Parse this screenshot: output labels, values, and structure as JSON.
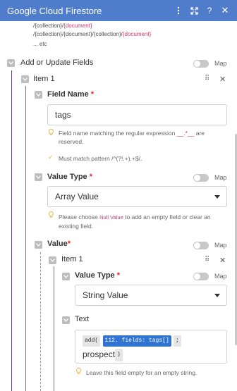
{
  "header": {
    "title": "Google Cloud Firestore",
    "icons": [
      "more-vertical-icon",
      "expand-icon",
      "help-icon",
      "close-icon"
    ]
  },
  "path_examples": {
    "line1_prefix": "/{collection}/",
    "line1_suffix": "{document}",
    "line2_prefix": "/{collection}/{document}/{collection}/",
    "line2_suffix": "{document}",
    "line3": "... etc"
  },
  "section": {
    "label": "Add or Update Fields",
    "map_label": "Map"
  },
  "item1": {
    "label": "Item 1",
    "field_name": {
      "label": "Field Name",
      "required_mark": "*",
      "value": "tags",
      "hint_prefix": "Field name matching the regular expression",
      "hint_code": "__.*__",
      "hint_suffix": "are reserved.",
      "pattern_hint": "Must match pattern /^(?!.+).+$/."
    },
    "value_type": {
      "label": "Value Type",
      "required_mark": "*",
      "map_label": "Map",
      "selected": "Array Value",
      "hint_prefix": "Please choose",
      "hint_code": "Null Value",
      "hint_suffix": "to add an empty field or clear an existing field."
    },
    "value": {
      "label": "Value",
      "required_mark": "*",
      "map_label": "Map",
      "item1": {
        "label": "Item 1",
        "value_type": {
          "label": "Value Type",
          "required_mark": "*",
          "map_label": "Map",
          "selected": "String Value"
        },
        "text": {
          "label": "Text",
          "chip_add": "add(",
          "chip_field": "112. fields: tags[]",
          "chip_sep": ";",
          "plain": "prospect",
          "chip_close": ")",
          "hint": "Leave this field empty for an empty string."
        }
      }
    }
  }
}
